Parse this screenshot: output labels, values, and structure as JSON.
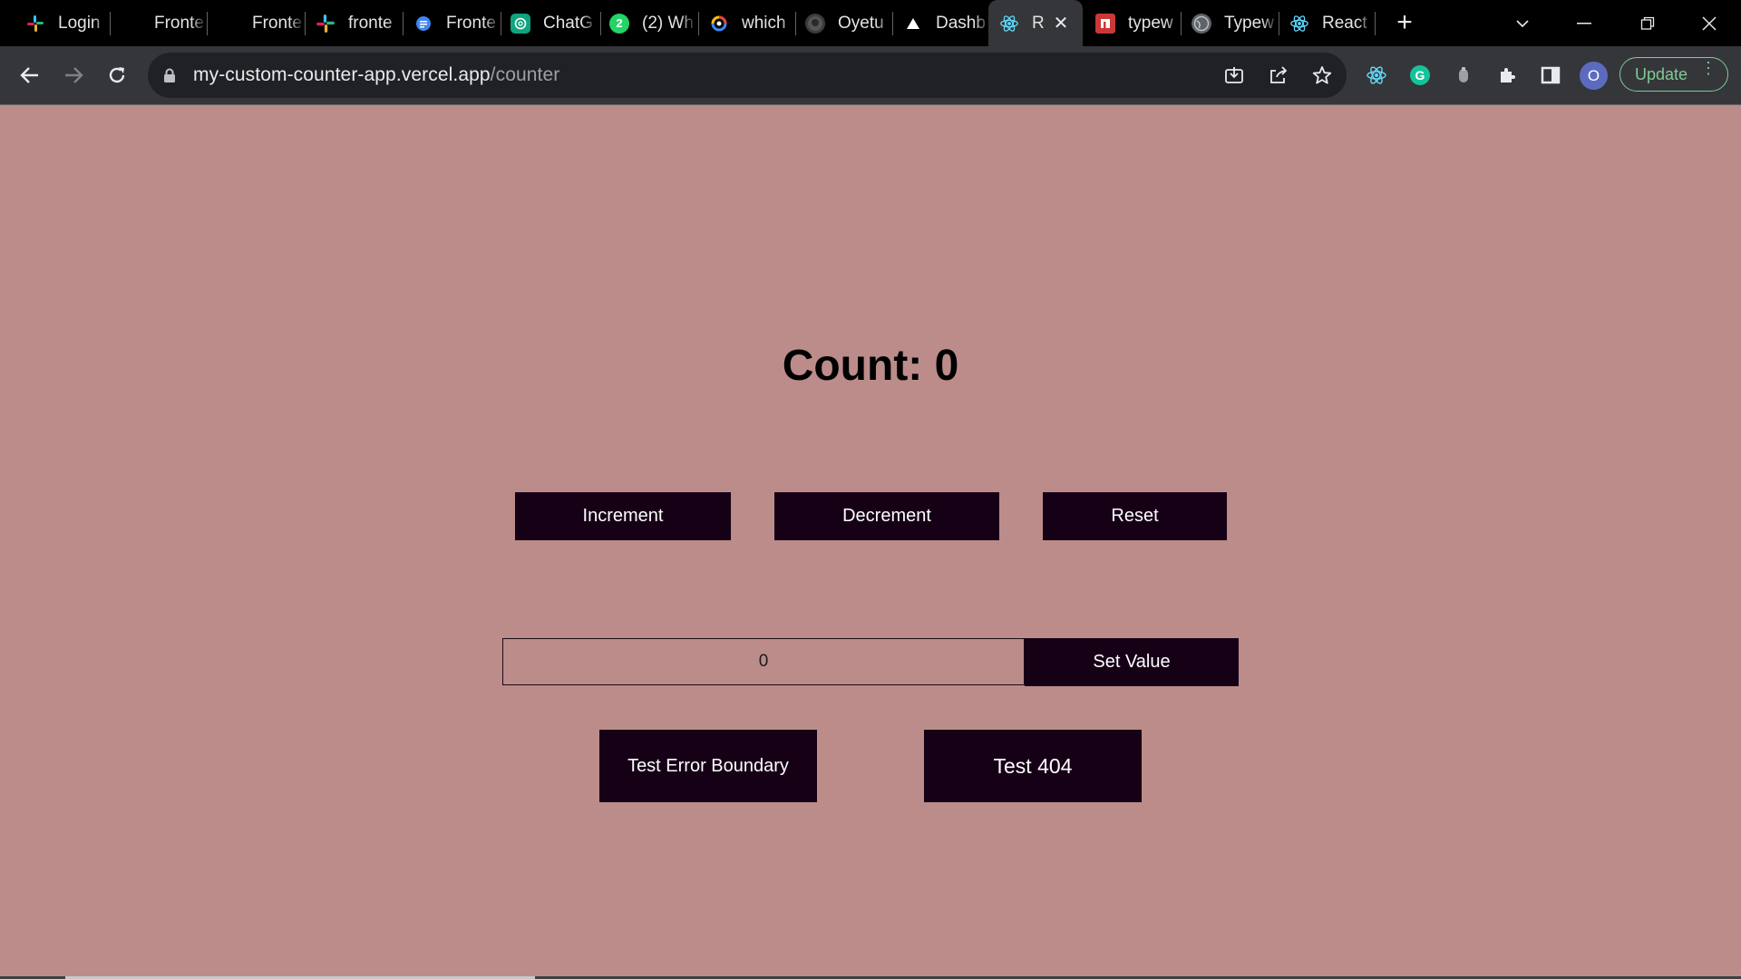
{
  "browser": {
    "tabs": [
      {
        "title": "Login",
        "icon": "slack-logo-icon",
        "color": "#e01e5a"
      },
      {
        "title": "Fronte",
        "icon": "blank-page-icon",
        "color": "#000000"
      },
      {
        "title": "Fronte",
        "icon": "blank-page-icon",
        "color": "#000000"
      },
      {
        "title": "fronte",
        "icon": "slack-logo-icon",
        "color": "#e01e5a"
      },
      {
        "title": "Fronte",
        "icon": "docs-icon",
        "color": "#4285f4"
      },
      {
        "title": "ChatG",
        "icon": "chatgpt-icon",
        "color": "#10a37f"
      },
      {
        "title": "(2) Wh",
        "icon": "whatsapp-icon",
        "color": "#25d366"
      },
      {
        "title": "which",
        "icon": "google-icon",
        "color": "#ffffff"
      },
      {
        "title": "Oyetu",
        "icon": "github-icon",
        "color": "#ffffff"
      },
      {
        "title": "Dashb",
        "icon": "vercel-icon",
        "color": "#ffffff"
      },
      {
        "title": "R",
        "icon": "react-icon",
        "color": "#61dafb",
        "active": true
      },
      {
        "title": "typew",
        "icon": "npm-icon",
        "color": "#cb3837"
      },
      {
        "title": "Typew",
        "icon": "globe-icon",
        "color": "#9aa0a6"
      },
      {
        "title": "React",
        "icon": "react-icon",
        "color": "#61dafb"
      }
    ],
    "url_host": "my-custom-counter-app.vercel.app",
    "url_path": "/counter",
    "update_label": "Update",
    "avatar_initial": "O"
  },
  "page": {
    "count_label": "Count: 0",
    "increment_label": "Increment",
    "decrement_label": "Decrement",
    "reset_label": "Reset",
    "value_input": "0",
    "set_value_label": "Set Value",
    "error_boundary_label": "Test Error Boundary",
    "test404_label": "Test 404"
  },
  "colors": {
    "page_background": "#bc8c8a",
    "button_background": "#160016",
    "button_text": "#ffffff"
  }
}
